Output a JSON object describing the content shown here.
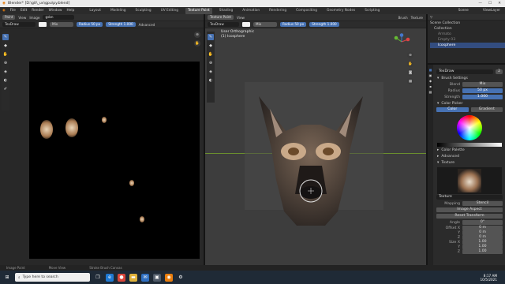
{
  "window": {
    "title": "Blender* [D:\\git\\_uv\\gpu\\py.blend]",
    "controls": [
      "—",
      "☐",
      "✕"
    ]
  },
  "menubar": {
    "menus": [
      "File",
      "Edit",
      "Render",
      "Window",
      "Help"
    ],
    "workspaces": [
      "Layout",
      "Modeling",
      "Sculpting",
      "UV Editing",
      "Texture Paint",
      "Shading",
      "Animation",
      "Rendering",
      "Compositing",
      "Geometry Nodes",
      "Scripting"
    ],
    "active_workspace": "Texture Paint",
    "scene": "Scene",
    "view_layer": "ViewLayer"
  },
  "left_editor": {
    "header": {
      "mode": "Paint",
      "view": "View",
      "image": "Image",
      "image_name": "gsbn"
    },
    "tool_settings": {
      "brush": "TexDraw",
      "blend": "Mix",
      "radius_label": "Radius",
      "radius_value": "50 px",
      "strength_label": "Strength",
      "strength_value": "1.000",
      "advanced": "Advanced"
    },
    "status": [
      "Image Paint",
      "Move View"
    ]
  },
  "viewport": {
    "header": {
      "mode": "Texture Paint",
      "view": "View",
      "brush_label": "Brush",
      "texture_label": "Texture"
    },
    "tool_settings": {
      "brush": "TexDraw",
      "blend": "Mix",
      "radius_label": "Radius",
      "radius_value": "50 px",
      "strength_label": "Strength",
      "strength_value": "1.000"
    },
    "overlay_title": "User Orthographic",
    "overlay_object": "(1) Icosphere",
    "status": "Stroke Brush Canvas"
  },
  "outliner": {
    "root": "Scene Collection",
    "items": [
      "Collection",
      "Armato",
      "Empty 03",
      "Icosphere"
    ]
  },
  "properties": {
    "brush_name": "TexDraw",
    "user_count": "2",
    "brush_settings_label": "Brush Settings",
    "blend_label": "Blend",
    "blend_value": "Mix",
    "radius_label": "Radius",
    "radius_value": "50 px",
    "strength_label": "Strength",
    "strength_value": "1.000",
    "color_picker_label": "Color Picker",
    "color_tab": "Color",
    "gradient_tab": "Gradient",
    "color_palette_label": "Color Palette",
    "advanced_label": "Advanced",
    "texture_label": "Texture",
    "texture_name": "Texture",
    "mapping_label": "Mapping",
    "mapping_value": "Stencil",
    "image_aspect_button": "Image Aspect",
    "reset_transform_button": "Reset Transform",
    "angle_label": "Angle",
    "angle_value": "0°",
    "offset_x_label": "Offset X",
    "offset_x_value": "0 m",
    "offset_y_label": "Y",
    "offset_y_value": "0 m",
    "offset_z_label": "Z",
    "offset_z_value": "0 m",
    "size_x_label": "Size X",
    "size_x_value": "1.00",
    "size_y_label": "Y",
    "size_y_value": "1.00",
    "size_z_label": "Z",
    "size_z_value": "1.00"
  },
  "taskbar": {
    "search_placeholder": "Type here to search",
    "time": "8:17 AM",
    "date": "10/5/2021"
  },
  "colors": {
    "accent": "#4772b3",
    "header": "#303030",
    "panel": "#2b2b2b"
  }
}
